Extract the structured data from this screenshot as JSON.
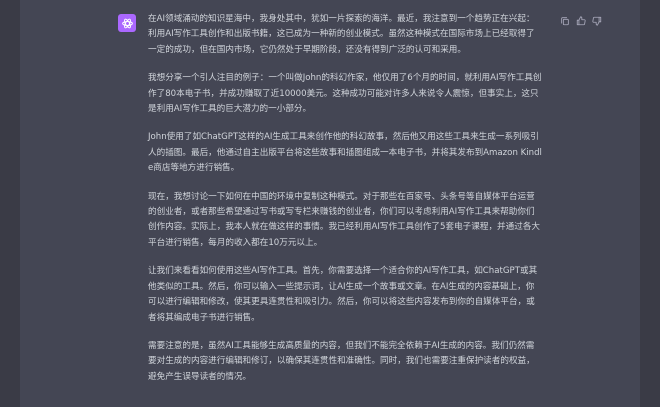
{
  "message": {
    "paragraphs": [
      "在AI领域涌动的知识星海中，我身处其中，犹如一片探索的海洋。最近，我注意到一个趋势正在兴起：利用AI写作工具创作和出版书籍，这已成为一种新的创业模式。虽然这种模式在国际市场上已经取得了一定的成功，但在国内市场，它仍然处于早期阶段，还没有得到广泛的认可和采用。",
      "我想分享一个引人注目的例子：一个叫做John的科幻作家，他仅用了6个月的时间，就利用AI写作工具创作了80本电子书，并成功赚取了近10000美元。这种成功可能对许多人来说令人震惊，但事实上，这只是利用AI写作工具的巨大潜力的一小部分。",
      "John使用了如ChatGPT这样的AI生成工具来创作他的科幻故事，然后他又用这些工具来生成一系列吸引人的插图。最后，他通过自主出版平台将这些故事和插图组成一本电子书，并将其发布到Amazon Kindle商店等地方进行销售。",
      "现在，我想讨论一下如何在中国的环境中复制这种模式。对于那些在百家号、头条号等自媒体平台运营的创业者，或者那些希望通过写书或写专栏来赚钱的创业者，你们可以考虑利用AI写作工具来帮助你们创作内容。实际上，我本人就在做这样的事情。我已经利用AI写作工具创作了5套电子课程，并通过各大平台进行销售，每月的收入都在10万元以上。",
      "让我们来看看如何使用这些AI写作工具。首先，你需要选择一个适合你的AI写作工具，如ChatGPT或其他类似的工具。然后，你可以输入一些提示词，让AI生成一个故事或文章。在AI生成的内容基础上，你可以进行编辑和修改，使其更具连贯性和吸引力。然后，你可以将这些内容发布到你的自媒体平台，或者将其编成电子书进行销售。",
      "需要注意的是，虽然AI工具能够生成高质量的内容，但我们不能完全依赖于AI生成的内容。我们仍然需要对生成的内容进行编辑和修订，以确保其连贯性和准确性。同时，我们也需要注重保护读者的权益，避免产生误导读者的情况。"
    ]
  },
  "colors": {
    "background": "#343541",
    "message_background": "#444654",
    "avatar": "#ab68ff",
    "text": "#d1d5db",
    "icon": "#acacbe"
  },
  "icons": {
    "avatar": "chatgpt-logo-icon",
    "actions": [
      "copy-icon",
      "thumbs-up-icon",
      "thumbs-down-icon"
    ]
  }
}
